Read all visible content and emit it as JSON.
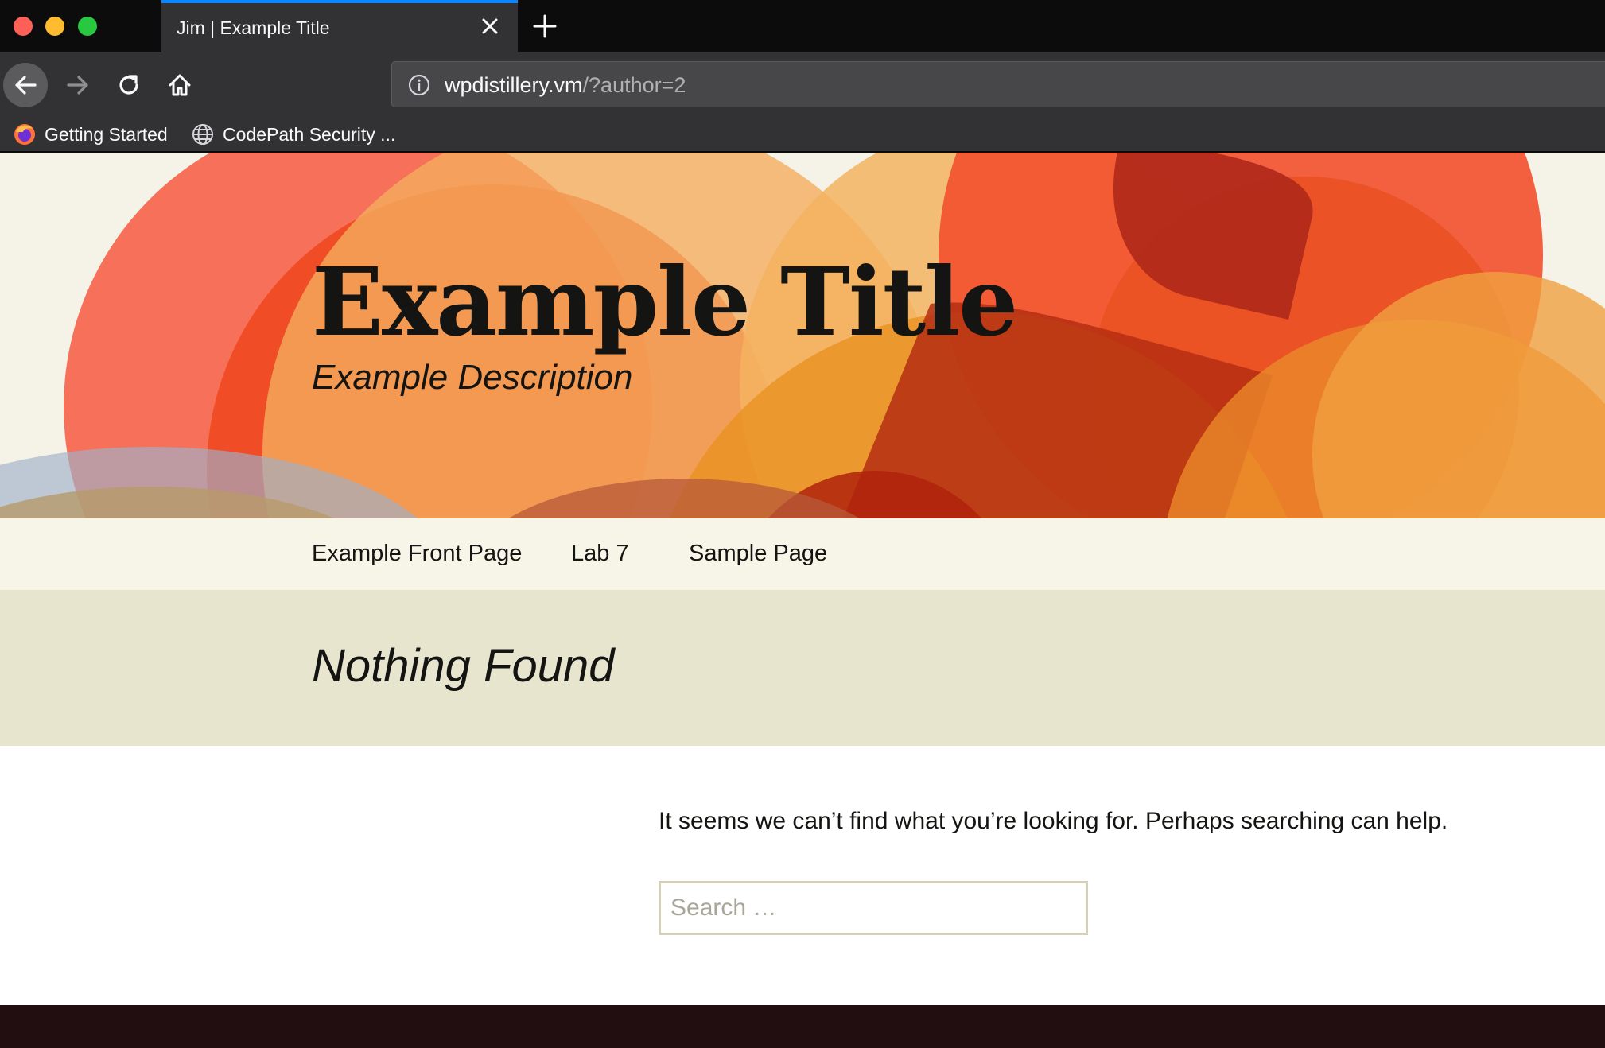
{
  "browser": {
    "tab": {
      "title": "Jim | Example Title"
    },
    "url": {
      "host": "wpdistillery.vm",
      "path": "/?author=2"
    },
    "bookmarks": [
      {
        "label": "Getting Started",
        "icon": "firefox-icon"
      },
      {
        "label": "CodePath Security ...",
        "icon": "globe-icon"
      }
    ],
    "colors": {
      "tab_accent": "#0a84ff",
      "chrome_dark": "#0c0c0d",
      "chrome": "#323234"
    }
  },
  "site": {
    "title": "Example Title",
    "description": "Example Description"
  },
  "menu": {
    "items": [
      {
        "label": "Example Front Page"
      },
      {
        "label": "Lab 7"
      },
      {
        "label": "Sample Page"
      }
    ]
  },
  "main": {
    "page_title": "Nothing Found",
    "message": "It seems we can’t find what you’re looking for. Perhaps searching can help.",
    "search": {
      "placeholder": "Search …",
      "value": ""
    }
  },
  "colors": {
    "header_bg": "#f5f3e8",
    "menu_bg": "#f7f5e7",
    "title_band_bg": "#e8e5ce",
    "footer_bg": "#220e10",
    "text": "#141412"
  }
}
